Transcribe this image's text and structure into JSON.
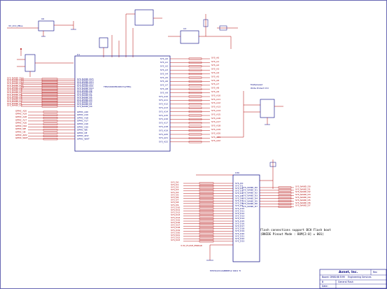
{
  "sheet": {
    "background": "#ffffff",
    "wire_color": "#b00000",
    "part_color": "#000080"
  },
  "labels": {
    "vcc_top_left": "3V_VCC_PBus",
    "mcu_part": "TMS320DM8168CYG(TMS)",
    "u_top_ldo": "U6",
    "u_mid": "U3",
    "mcu_ref": "U1",
    "flash_ref": "U30",
    "flash_part": "MT25QL512ABB8E12 0001 TI",
    "mux_note": "Multiplexed",
    "mux_note2": "Write Protect Ctrl",
    "flash_note_line1": "Flash connections support BCH Flash boot",
    "flash_note_line2": "(BNIDE Pinout Mode : BOM[2:0] = 001)",
    "bottom_left_net": "3.3V_FLASH_PWRGD",
    "tb_company": "Avnet, Inc.",
    "tb_dept": "Engineering Services",
    "tb_board": "Board: DM8168 EVM",
    "tb_sheet_label": "General Flash",
    "tb_size": "B",
    "tb_date": "Date:",
    "tb_rev": "Rev"
  },
  "left_nets": [
    "SYS_NAND_D15",
    "SYS_NAND_D14",
    "SYS_NAND_D13",
    "SYS_NAND_D12",
    "SYS_NAND_D11",
    "SYS_NAND_D10",
    "SYS_NAND_D9",
    "SYS_NAND_D8",
    "SYS_NAND_D7",
    "SYS_NAND_D6",
    "SYS_NAND_D5",
    "SYS_NAND_D4",
    "SYS_NAND_D3",
    "SYS_NAND_D2",
    "SYS_NAND_D1",
    "SYS_NAND_D0"
  ],
  "left_nets_b": [
    "GPMC_A20",
    "GPMC_A19",
    "GPMC_A18",
    "GPMC_A17",
    "GPMC_A16",
    "GPMC_CS0",
    "GPMC_WE",
    "GPMC_OE",
    "GPMC_ADV",
    "GPMC_WAIT"
  ],
  "right_nets": [
    "SYS_A0",
    "SYS_A1",
    "SYS_A2",
    "SYS_A3",
    "SYS_A4",
    "SYS_A5",
    "SYS_A6",
    "SYS_A7",
    "SYS_A8",
    "SYS_A9",
    "SYS_A10",
    "SYS_A11",
    "SYS_A12",
    "SYS_A13",
    "SYS_A14",
    "SYS_A15",
    "SYS_A16",
    "SYS_A17",
    "SYS_A18",
    "SYS_A19",
    "SYS_A20",
    "SYS_A21",
    "SYS_A22"
  ],
  "flash_left_nets": [
    "SYS_D0",
    "SYS_D1",
    "SYS_D2",
    "SYS_D3",
    "SYS_D4",
    "SYS_D5",
    "SYS_D6",
    "SYS_D7",
    "SYS_D8",
    "SYS_D9",
    "SYS_D10",
    "SYS_D11",
    "SYS_D12",
    "SYS_D13",
    "SYS_D14",
    "SYS_D15",
    "SYS_D16",
    "SYS_D17",
    "SYS_D18",
    "SYS_D19",
    "SYS_D20",
    "SYS_D21",
    "SYS_D22",
    "SYS_D23"
  ],
  "flash_right_nets": [
    "SYS_NAND_D0",
    "SYS_NAND_D1",
    "SYS_NAND_D2",
    "SYS_NAND_D3",
    "SYS_NAND_D4",
    "SYS_NAND_D5",
    "SYS_NAND_D6",
    "SYS_NAND_D7"
  ]
}
